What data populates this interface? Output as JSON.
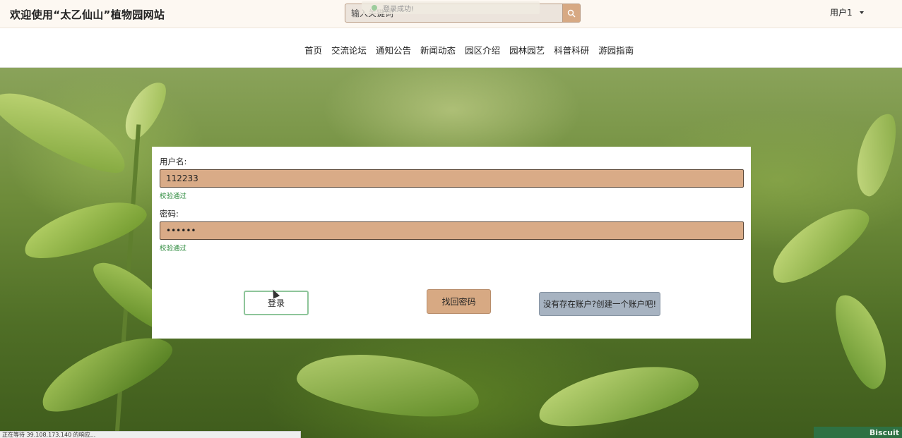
{
  "header": {
    "site_title": "欢迎使用“太乙仙山”植物园网站",
    "search_placeholder": "输入关键词",
    "search_icon": "search-icon",
    "toast": "登录成功!",
    "user_label": "用户1"
  },
  "nav": {
    "items": [
      "首页",
      "交流论坛",
      "通知公告",
      "新闻动态",
      "园区介绍",
      "园林园艺",
      "科普科研",
      "游园指南"
    ]
  },
  "login": {
    "username_label": "用户名:",
    "username_value": "112233",
    "username_status": "校验通过",
    "password_label": "密码:",
    "password_value": "••••••",
    "password_status": "校验通过",
    "login_button": "登录",
    "forgot_button": "找回密码",
    "register_button": "没有存在账户?创建一个账户吧!"
  },
  "status_bar": "正在等待 39.108.173.140 的响应...",
  "watermark": "Biscuit",
  "colors": {
    "input_bg": "#d9ab87",
    "forgot_bg": "#d7a983",
    "register_bg": "#a7b3c1",
    "valid": "#2e8b3e"
  }
}
